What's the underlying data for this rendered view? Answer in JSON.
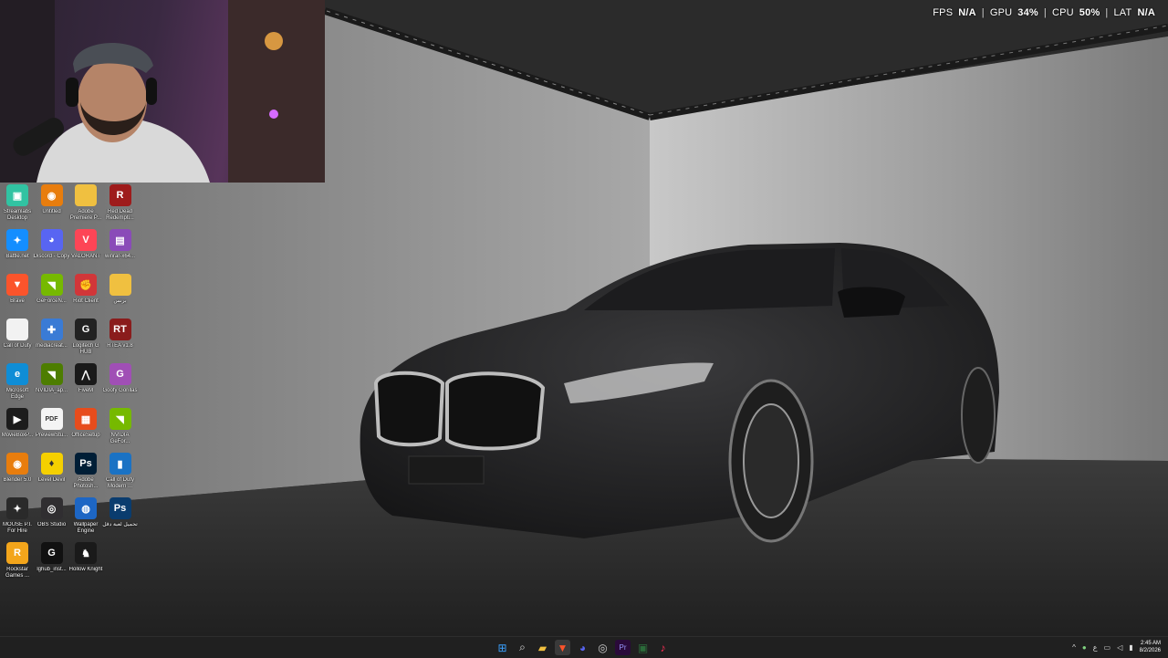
{
  "overlay": {
    "fps_label": "FPS",
    "fps_value": "N/A",
    "gpu_label": "GPU",
    "gpu_value": "34",
    "cpu_label": "CPU",
    "cpu_value": "50",
    "lat_label": "LAT",
    "lat_value": "N/A",
    "separator": "|",
    "percent": "%"
  },
  "desktop_icons": [
    {
      "label": "Streamlabs Desktop",
      "icon": "streamlabs-icon",
      "color": "#31c3a2"
    },
    {
      "label": "Untitled",
      "icon": "blender-file-icon",
      "color": "#e87d0d"
    },
    {
      "label": "Adobe Premiere P...",
      "icon": "folder-icon",
      "color": "#f0c040"
    },
    {
      "label": "Red Dead Redempti...",
      "icon": "rdr2-icon",
      "color": "#9e1b1b"
    },
    {
      "label": "Battle.net",
      "icon": "battlenet-icon",
      "color": "#148eff"
    },
    {
      "label": "Discord - Copy",
      "icon": "discord-icon",
      "color": "#5865f2"
    },
    {
      "label": "VALORANT",
      "icon": "valorant-icon",
      "color": "#fd4556"
    },
    {
      "label": "winrar-x64...",
      "icon": "winrar-icon",
      "color": "#8a4bb8"
    },
    {
      "label": "Brave",
      "icon": "brave-icon",
      "color": "#fb542b"
    },
    {
      "label": "GeForceN...",
      "icon": "nvidia-icon",
      "color": "#76b900"
    },
    {
      "label": "Riot Client",
      "icon": "riot-icon",
      "color": "#d13639"
    },
    {
      "label": "برنس",
      "icon": "folder-icon",
      "color": "#f0c040"
    },
    {
      "label": "Call of Duty",
      "icon": "document-icon",
      "color": "#f2f2f2"
    },
    {
      "label": "mediacreat...",
      "icon": "media-creation-icon",
      "color": "#3a7bd5"
    },
    {
      "label": "Logitech G HUB",
      "icon": "logitech-icon",
      "color": "#222222"
    },
    {
      "label": "RTEA v1.8",
      "icon": "rtea-icon",
      "color": "#8a1c1c"
    },
    {
      "label": "Microsoft Edge",
      "icon": "edge-icon",
      "color": "#0f8dd6"
    },
    {
      "label": "NVIDIA_ap...",
      "icon": "nvidia-installer-icon",
      "color": "#4d7d00"
    },
    {
      "label": "FiveM",
      "icon": "fivem-icon",
      "color": "#1a1a1a"
    },
    {
      "label": "Goofy Gorillas",
      "icon": "goofy-gorillas-icon",
      "color": "#a04fb5"
    },
    {
      "label": "MovieBoxP...",
      "icon": "moviebox-icon",
      "color": "#1c1c1c"
    },
    {
      "label": "PreviewStu...",
      "icon": "pdf-icon",
      "color": "#f4f4f4"
    },
    {
      "label": "OfficeSetup",
      "icon": "office-icon",
      "color": "#e74c1c"
    },
    {
      "label": "NVIDIA GeFor...",
      "icon": "nvidia-icon",
      "color": "#76b900"
    },
    {
      "label": "Blender 5.0",
      "icon": "blender-icon",
      "color": "#e87d0d"
    },
    {
      "label": "Level Devil",
      "icon": "level-devil-icon",
      "color": "#f5d000"
    },
    {
      "label": "Adobe Photosh...",
      "icon": "photoshop-icon",
      "color": "#001e36"
    },
    {
      "label": "Call of Duty Modern ...",
      "icon": "cod-modern-icon",
      "color": "#1a72c4"
    },
    {
      "label": "MOUSE P.I. For Hire",
      "icon": "mouse-pi-icon",
      "color": "#2a2a2a"
    },
    {
      "label": "OBS Studio",
      "icon": "obs-icon",
      "color": "#302e31"
    },
    {
      "label": "Wallpaper Engine",
      "icon": "wallpaper-engine-icon",
      "color": "#1d66c4"
    },
    {
      "label": "تحميل لعبة دقل",
      "icon": "psd-file-icon",
      "color": "#0a3c6e"
    },
    {
      "label": "Rockstar Games ...",
      "icon": "rockstar-icon",
      "color": "#f3a51b"
    },
    {
      "label": "lghub_inst...",
      "icon": "logitech-installer-icon",
      "color": "#111111"
    },
    {
      "label": "Hollow Knight",
      "icon": "hollow-knight-icon",
      "color": "#1a1a1a"
    }
  ],
  "taskbar": {
    "apps": [
      {
        "icon": "windows-start-icon",
        "color": "#3aa0ff"
      },
      {
        "icon": "search-icon",
        "color": "#dddddd"
      },
      {
        "icon": "file-explorer-icon",
        "color": "#f0c040"
      },
      {
        "icon": "brave-icon",
        "color": "#fb542b"
      },
      {
        "icon": "discord-icon",
        "color": "#5865f2"
      },
      {
        "icon": "chrome-icon",
        "color": "#cccccc"
      },
      {
        "icon": "premiere-icon",
        "color": "#9999ff"
      },
      {
        "icon": "terminal-icon",
        "color": "#2b6b3a"
      },
      {
        "icon": "tiktok-icon",
        "color": "#ff2d55"
      }
    ],
    "tray": {
      "chevron_icon": "chevron-up-icon",
      "mic_icon": "microphone-icon",
      "lang": "ع",
      "network_icon": "network-icon",
      "volume_icon": "volume-icon",
      "battery_icon": "battery-icon",
      "time": "2:45 AM",
      "date": "8/2/2026"
    }
  }
}
